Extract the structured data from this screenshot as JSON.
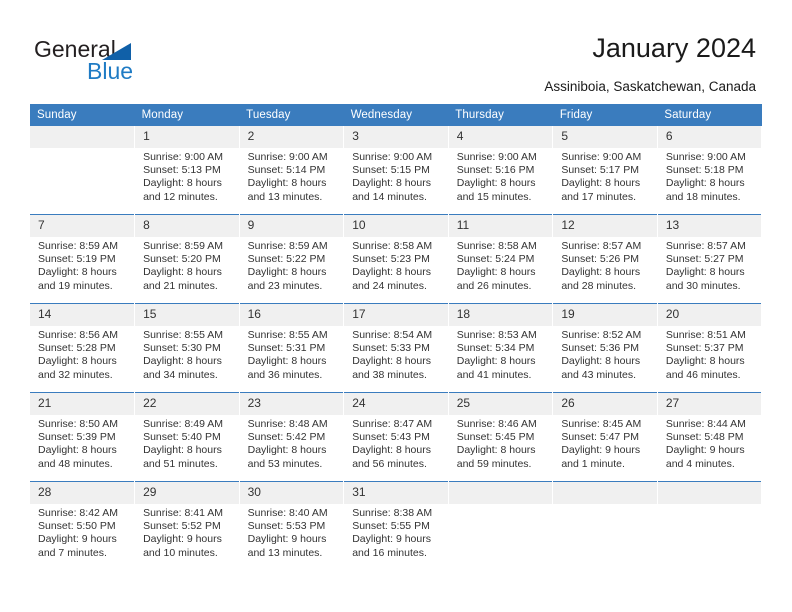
{
  "logo": {
    "word1": "General",
    "word2": "Blue",
    "triangle_color": "#1060a8",
    "blue_color": "#1f7bc4"
  },
  "header": {
    "title": "January 2024",
    "subtitle": "Assiniboia, Saskatchewan, Canada"
  },
  "theme": {
    "header_blue": "#3a7cbe",
    "daynum_background": "#f0f0f0",
    "text": "#333333"
  },
  "calendar": {
    "weekday_headers": [
      "Sunday",
      "Monday",
      "Tuesday",
      "Wednesday",
      "Thursday",
      "Friday",
      "Saturday"
    ],
    "weeks": [
      [
        {
          "day": "",
          "sunrise": "",
          "sunset": "",
          "daylight1": "",
          "daylight2": ""
        },
        {
          "day": "1",
          "sunrise": "Sunrise: 9:00 AM",
          "sunset": "Sunset: 5:13 PM",
          "daylight1": "Daylight: 8 hours",
          "daylight2": "and 12 minutes."
        },
        {
          "day": "2",
          "sunrise": "Sunrise: 9:00 AM",
          "sunset": "Sunset: 5:14 PM",
          "daylight1": "Daylight: 8 hours",
          "daylight2": "and 13 minutes."
        },
        {
          "day": "3",
          "sunrise": "Sunrise: 9:00 AM",
          "sunset": "Sunset: 5:15 PM",
          "daylight1": "Daylight: 8 hours",
          "daylight2": "and 14 minutes."
        },
        {
          "day": "4",
          "sunrise": "Sunrise: 9:00 AM",
          "sunset": "Sunset: 5:16 PM",
          "daylight1": "Daylight: 8 hours",
          "daylight2": "and 15 minutes."
        },
        {
          "day": "5",
          "sunrise": "Sunrise: 9:00 AM",
          "sunset": "Sunset: 5:17 PM",
          "daylight1": "Daylight: 8 hours",
          "daylight2": "and 17 minutes."
        },
        {
          "day": "6",
          "sunrise": "Sunrise: 9:00 AM",
          "sunset": "Sunset: 5:18 PM",
          "daylight1": "Daylight: 8 hours",
          "daylight2": "and 18 minutes."
        }
      ],
      [
        {
          "day": "7",
          "sunrise": "Sunrise: 8:59 AM",
          "sunset": "Sunset: 5:19 PM",
          "daylight1": "Daylight: 8 hours",
          "daylight2": "and 19 minutes."
        },
        {
          "day": "8",
          "sunrise": "Sunrise: 8:59 AM",
          "sunset": "Sunset: 5:20 PM",
          "daylight1": "Daylight: 8 hours",
          "daylight2": "and 21 minutes."
        },
        {
          "day": "9",
          "sunrise": "Sunrise: 8:59 AM",
          "sunset": "Sunset: 5:22 PM",
          "daylight1": "Daylight: 8 hours",
          "daylight2": "and 23 minutes."
        },
        {
          "day": "10",
          "sunrise": "Sunrise: 8:58 AM",
          "sunset": "Sunset: 5:23 PM",
          "daylight1": "Daylight: 8 hours",
          "daylight2": "and 24 minutes."
        },
        {
          "day": "11",
          "sunrise": "Sunrise: 8:58 AM",
          "sunset": "Sunset: 5:24 PM",
          "daylight1": "Daylight: 8 hours",
          "daylight2": "and 26 minutes."
        },
        {
          "day": "12",
          "sunrise": "Sunrise: 8:57 AM",
          "sunset": "Sunset: 5:26 PM",
          "daylight1": "Daylight: 8 hours",
          "daylight2": "and 28 minutes."
        },
        {
          "day": "13",
          "sunrise": "Sunrise: 8:57 AM",
          "sunset": "Sunset: 5:27 PM",
          "daylight1": "Daylight: 8 hours",
          "daylight2": "and 30 minutes."
        }
      ],
      [
        {
          "day": "14",
          "sunrise": "Sunrise: 8:56 AM",
          "sunset": "Sunset: 5:28 PM",
          "daylight1": "Daylight: 8 hours",
          "daylight2": "and 32 minutes."
        },
        {
          "day": "15",
          "sunrise": "Sunrise: 8:55 AM",
          "sunset": "Sunset: 5:30 PM",
          "daylight1": "Daylight: 8 hours",
          "daylight2": "and 34 minutes."
        },
        {
          "day": "16",
          "sunrise": "Sunrise: 8:55 AM",
          "sunset": "Sunset: 5:31 PM",
          "daylight1": "Daylight: 8 hours",
          "daylight2": "and 36 minutes."
        },
        {
          "day": "17",
          "sunrise": "Sunrise: 8:54 AM",
          "sunset": "Sunset: 5:33 PM",
          "daylight1": "Daylight: 8 hours",
          "daylight2": "and 38 minutes."
        },
        {
          "day": "18",
          "sunrise": "Sunrise: 8:53 AM",
          "sunset": "Sunset: 5:34 PM",
          "daylight1": "Daylight: 8 hours",
          "daylight2": "and 41 minutes."
        },
        {
          "day": "19",
          "sunrise": "Sunrise: 8:52 AM",
          "sunset": "Sunset: 5:36 PM",
          "daylight1": "Daylight: 8 hours",
          "daylight2": "and 43 minutes."
        },
        {
          "day": "20",
          "sunrise": "Sunrise: 8:51 AM",
          "sunset": "Sunset: 5:37 PM",
          "daylight1": "Daylight: 8 hours",
          "daylight2": "and 46 minutes."
        }
      ],
      [
        {
          "day": "21",
          "sunrise": "Sunrise: 8:50 AM",
          "sunset": "Sunset: 5:39 PM",
          "daylight1": "Daylight: 8 hours",
          "daylight2": "and 48 minutes."
        },
        {
          "day": "22",
          "sunrise": "Sunrise: 8:49 AM",
          "sunset": "Sunset: 5:40 PM",
          "daylight1": "Daylight: 8 hours",
          "daylight2": "and 51 minutes."
        },
        {
          "day": "23",
          "sunrise": "Sunrise: 8:48 AM",
          "sunset": "Sunset: 5:42 PM",
          "daylight1": "Daylight: 8 hours",
          "daylight2": "and 53 minutes."
        },
        {
          "day": "24",
          "sunrise": "Sunrise: 8:47 AM",
          "sunset": "Sunset: 5:43 PM",
          "daylight1": "Daylight: 8 hours",
          "daylight2": "and 56 minutes."
        },
        {
          "day": "25",
          "sunrise": "Sunrise: 8:46 AM",
          "sunset": "Sunset: 5:45 PM",
          "daylight1": "Daylight: 8 hours",
          "daylight2": "and 59 minutes."
        },
        {
          "day": "26",
          "sunrise": "Sunrise: 8:45 AM",
          "sunset": "Sunset: 5:47 PM",
          "daylight1": "Daylight: 9 hours",
          "daylight2": "and 1 minute."
        },
        {
          "day": "27",
          "sunrise": "Sunrise: 8:44 AM",
          "sunset": "Sunset: 5:48 PM",
          "daylight1": "Daylight: 9 hours",
          "daylight2": "and 4 minutes."
        }
      ],
      [
        {
          "day": "28",
          "sunrise": "Sunrise: 8:42 AM",
          "sunset": "Sunset: 5:50 PM",
          "daylight1": "Daylight: 9 hours",
          "daylight2": "and 7 minutes."
        },
        {
          "day": "29",
          "sunrise": "Sunrise: 8:41 AM",
          "sunset": "Sunset: 5:52 PM",
          "daylight1": "Daylight: 9 hours",
          "daylight2": "and 10 minutes."
        },
        {
          "day": "30",
          "sunrise": "Sunrise: 8:40 AM",
          "sunset": "Sunset: 5:53 PM",
          "daylight1": "Daylight: 9 hours",
          "daylight2": "and 13 minutes."
        },
        {
          "day": "31",
          "sunrise": "Sunrise: 8:38 AM",
          "sunset": "Sunset: 5:55 PM",
          "daylight1": "Daylight: 9 hours",
          "daylight2": "and 16 minutes."
        },
        {
          "day": "",
          "sunrise": "",
          "sunset": "",
          "daylight1": "",
          "daylight2": ""
        },
        {
          "day": "",
          "sunrise": "",
          "sunset": "",
          "daylight1": "",
          "daylight2": ""
        },
        {
          "day": "",
          "sunrise": "",
          "sunset": "",
          "daylight1": "",
          "daylight2": ""
        }
      ]
    ]
  }
}
